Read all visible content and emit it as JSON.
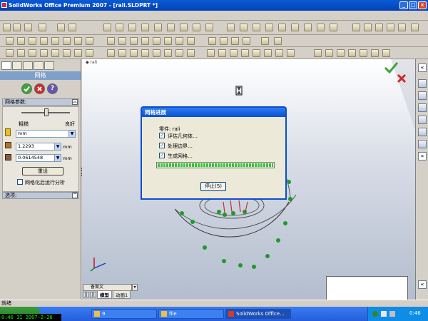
{
  "window": {
    "title": "SolidWorks Office Premium 2007 - [rali.SLDPRT *]"
  },
  "feature_manager": {
    "tree_root": "rali",
    "panel_title": "网格",
    "mesh_params": {
      "header": "网格参数:",
      "coarse_label": "粗糙",
      "fine_label": "良好",
      "slider_level": 0.5,
      "unit_select": "mm",
      "global_size": "1.2293",
      "global_size_unit": "mm",
      "tolerance": "0.0614548",
      "tolerance_unit": "mm",
      "reset_button": "重设",
      "run_after_mesh_label": "网格化后运行分析"
    },
    "options_header": "选项:"
  },
  "dialog": {
    "title": "网格进展",
    "part_label": "零件: rali",
    "steps": [
      "评估几何体…",
      "处理边界…",
      "生成网格…"
    ],
    "progress": 1.0,
    "stop_button": "停止(S)"
  },
  "bottom_tabs": {
    "sheet_name": "备案文",
    "model_tab": "模型",
    "animation_tab": "动画1"
  },
  "status_bar": {
    "text": "就绪"
  },
  "taskbar": {
    "clock_overlay": "0:46 31 2007-2-26",
    "tasks": [
      {
        "label": "9"
      },
      {
        "label": "file"
      },
      {
        "label": "SolidWorks Office..."
      }
    ],
    "tray_time": "0:46"
  },
  "colors": {
    "titlebar": "#0a5bd6",
    "panel_title": "#7ea0c9",
    "accept_green": "#3aa63a",
    "cancel_red": "#d12a2a",
    "progress_green": "#34c834",
    "mesh_arrow_green": "#1f9a2a",
    "mesh_arrow_red": "#c83030"
  },
  "icons": [
    "check-icon",
    "x-icon",
    "help-icon",
    "hourglass-icon",
    "triad-icon"
  ]
}
